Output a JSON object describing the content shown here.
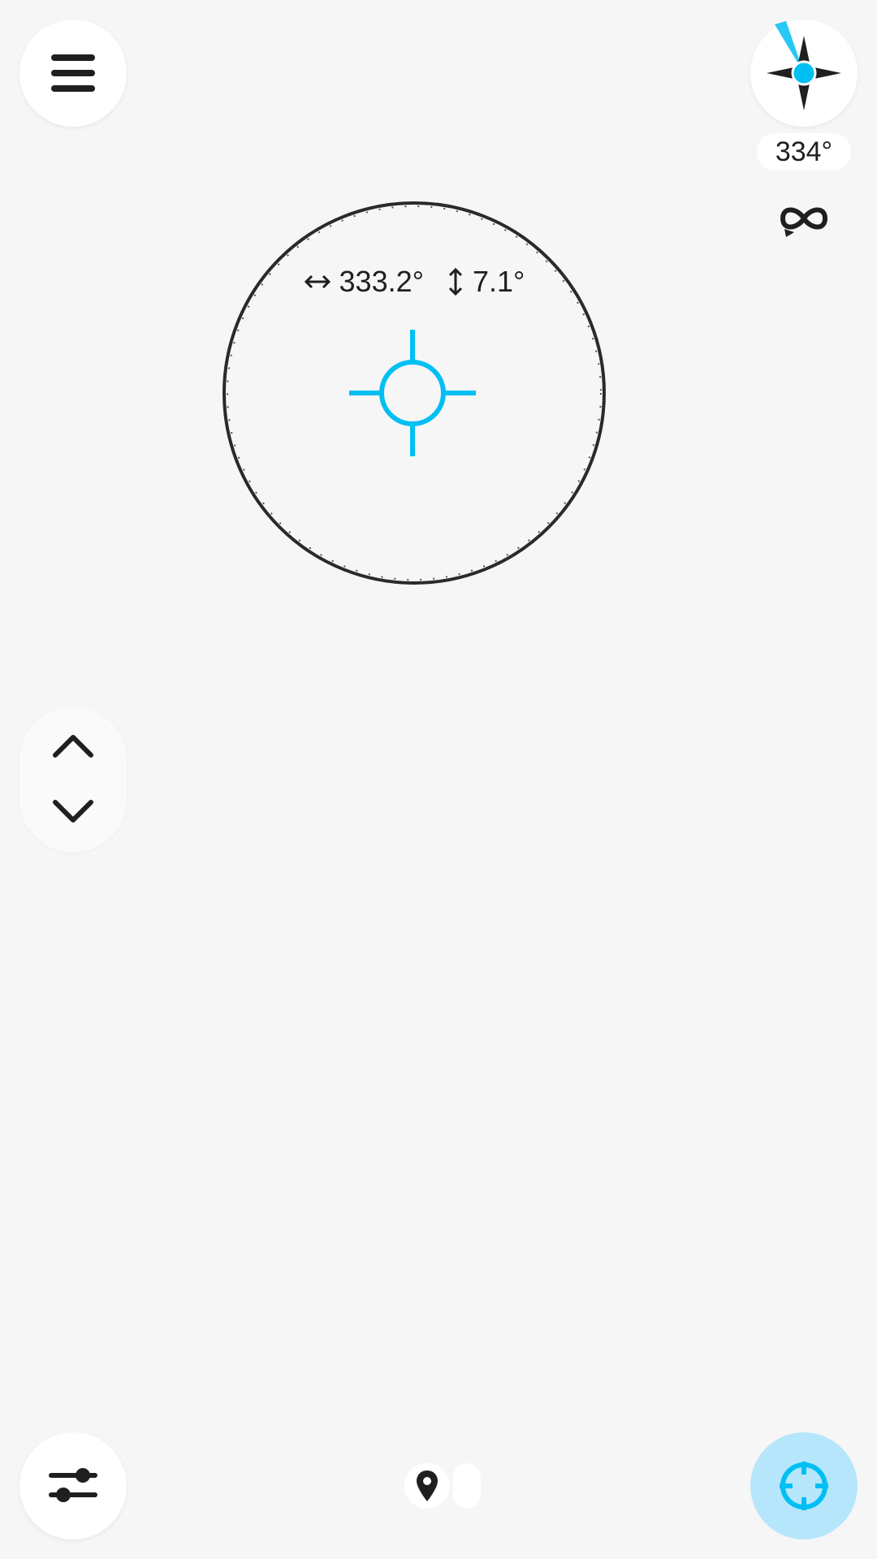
{
  "compass": {
    "heading_label": "334°",
    "icon": "compass-rose-icon",
    "accent_color": "#00bff3"
  },
  "navigation": {
    "azimuth_label": "333.2°",
    "elevation_label": "7.1°",
    "azimuth_icon": "horizontal-arrows-icon",
    "elevation_icon": "vertical-arrows-icon"
  },
  "toolbar": {
    "menu_icon": "menu-icon",
    "loop_icon": "loop-icon",
    "filter_icon": "sliders-icon",
    "target_icon": "crosshair-target-icon",
    "up_icon": "chevron-up-icon",
    "down_icon": "chevron-down-icon",
    "beacon_icon": "location-pin-icon"
  },
  "colors": {
    "background": "#f6f6f6",
    "accent": "#00bff3",
    "target_button_bg": "#b6e6fb"
  }
}
